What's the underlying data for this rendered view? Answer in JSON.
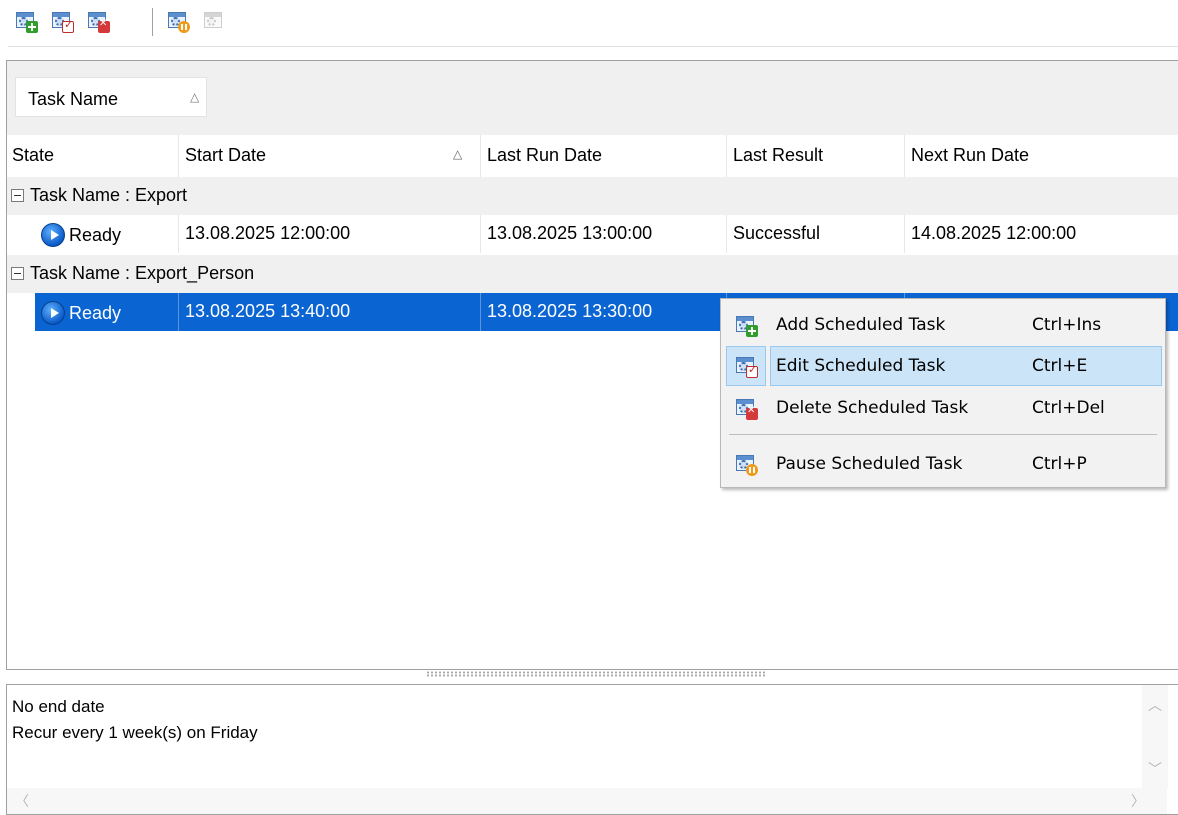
{
  "toolbar": {
    "buttons": [
      {
        "icon": "add-task-icon",
        "enabled": true
      },
      {
        "icon": "edit-task-icon",
        "enabled": true
      },
      {
        "icon": "delete-task-icon",
        "enabled": true
      },
      {
        "icon": "pause-task-icon",
        "enabled": true
      },
      {
        "icon": "resume-task-icon",
        "enabled": false
      }
    ]
  },
  "grid": {
    "group_by": {
      "label": "Task Name",
      "sort": "△"
    },
    "columns": [
      {
        "label": "State",
        "sort": ""
      },
      {
        "label": "Start Date",
        "sort": "△"
      },
      {
        "label": "Last Run Date",
        "sort": ""
      },
      {
        "label": "Last Result",
        "sort": ""
      },
      {
        "label": "Next Run Date",
        "sort": ""
      }
    ],
    "groups": [
      {
        "header": "Task Name : Export",
        "rows": [
          {
            "state": "Ready",
            "start": "13.08.2025 12:00:00",
            "last_run": "13.08.2025 13:00:00",
            "last_result": "Successful",
            "next_run": "14.08.2025 12:00:00"
          }
        ]
      },
      {
        "header": "Task Name : Export_Person",
        "rows": [
          {
            "state": "Ready",
            "start": "13.08.2025 13:40:00",
            "last_run": "13.08.2025 13:30:00",
            "last_result": "",
            "next_run": ""
          }
        ]
      }
    ],
    "selection_color": "#0a64d2"
  },
  "context_menu": {
    "items": [
      {
        "label": "Add Scheduled Task",
        "shortcut": "Ctrl+Ins",
        "icon": "add-task-icon"
      },
      {
        "label": "Edit Scheduled Task",
        "shortcut": "Ctrl+E",
        "icon": "edit-task-icon"
      },
      {
        "label": "Delete Scheduled Task",
        "shortcut": "Ctrl+Del",
        "icon": "delete-task-icon"
      },
      {
        "label": "Pause Scheduled Task",
        "shortcut": "Ctrl+P",
        "icon": "pause-task-icon"
      }
    ]
  },
  "description": {
    "lines": [
      "No end date",
      "Recur every 1 week(s) on Friday"
    ]
  }
}
